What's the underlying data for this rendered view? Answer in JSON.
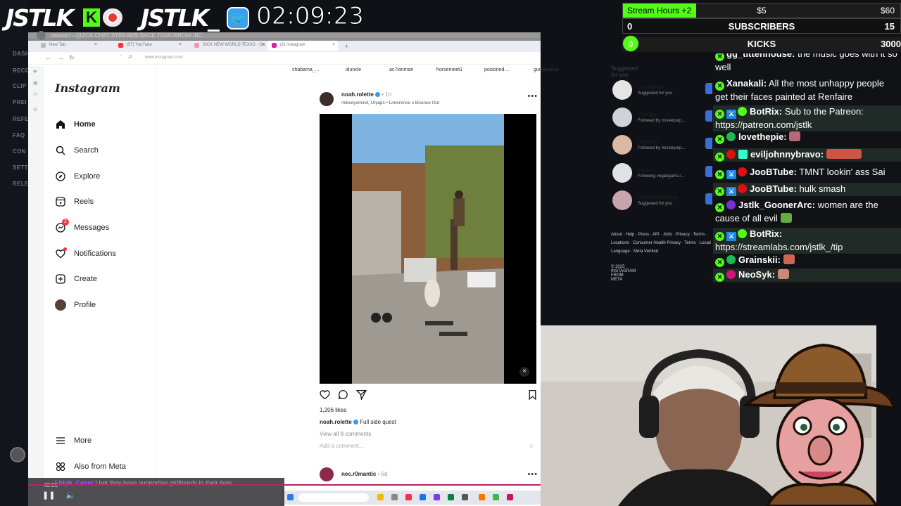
{
  "overlay": {
    "logo_left": "JSTLK",
    "logo_right": "JSTLK_",
    "kick_letter": "K",
    "twitter_glyph": "🐦",
    "timer": "02:09:23",
    "stream_title": "danasirl - QUICK CHAT STREAMS BACK TOMORROW IBC"
  },
  "goals": {
    "hours_label": "Stream Hours +2",
    "hours_mid": "$5",
    "hours_right": "$60",
    "subs_left": "0",
    "subs_label": "SUBSCRIBERS",
    "subs_right": "15",
    "kicks_left": "0",
    "kicks_label": "KICKS",
    "kicks_right": "3000",
    "accent": "#53fc18"
  },
  "dashboard": {
    "items": [
      "DASH",
      "RECO",
      "CLIP",
      "PREI",
      "REFE",
      "FAQ",
      "CON",
      "SETT",
      "RELE"
    ]
  },
  "browser": {
    "tabs": [
      "New Tab",
      "(57) YouTube",
      "SICK NEW WORLD TEXAS - Go",
      "(2) Instagram"
    ],
    "url": "www.instagram.com"
  },
  "instagram": {
    "logo": "Instagram",
    "nav": [
      {
        "label": "Home",
        "icon": "home-icon"
      },
      {
        "label": "Search",
        "icon": "search-icon"
      },
      {
        "label": "Explore",
        "icon": "compass-icon"
      },
      {
        "label": "Reels",
        "icon": "reels-icon"
      },
      {
        "label": "Messages",
        "icon": "messenger-icon"
      },
      {
        "label": "Notifications",
        "icon": "heart-icon"
      },
      {
        "label": "Create",
        "icon": "plus-square-icon"
      },
      {
        "label": "Profile",
        "icon": "profile-icon"
      }
    ],
    "messages_badge": "2",
    "more_label": "More",
    "meta_label": "Also from Meta",
    "stories": [
      "shabama_...",
      "iduncle",
      "ac7ionman",
      "horsemeet1",
      "poisoned....",
      "gumawawa"
    ],
    "post": {
      "user": "noah.rolette",
      "time": "• 1h",
      "subline": "mikeeysmind, Unjaps • Limerence x Bounce Out",
      "likes": "1,206 likes",
      "caption_user": "noah.rolette",
      "caption_text": "Full side quest",
      "view_comments": "View all 8 comments",
      "add_comment": "Add a comment..."
    },
    "next_post": {
      "user": "nec.r0mantic",
      "time": "• 6d"
    },
    "suggested_title": "Suggested for you",
    "suggestions": [
      {
        "name": "aracelbitch",
        "sub": "Suggested for you"
      },
      {
        "name": "_cxclips_",
        "sub": "Followed by mrseepurp..."
      },
      {
        "name": "andiraytv",
        "sub": "Followed by mrseepurp..."
      },
      {
        "name": "lav.jus",
        "sub": "Following vegangains.r..."
      },
      {
        "name": "mistressrubyroze",
        "sub": "Suggested for you"
      }
    ],
    "footer": "About · Help · Press · API · Jobs · Privacy · Terms · Locations · Consumer Health Privacy · Terms · Locati Language · Meta Verified",
    "copyright": "© 2025 INSTAGRAM FROM META"
  },
  "vod": {
    "time": "43:06",
    "comment_user": "Lhigh_Caner",
    "comment_text": "I bet they have supportive girlfriends in their lives"
  },
  "chat": [
    {
      "user": "gg_tittenhouse:",
      "msg": " the music goes with it so well",
      "badges": [
        "kick"
      ]
    },
    {
      "user": "Xanakali:",
      "msg": " All the most unhappy people get their faces painted at Renfaire",
      "badges": [
        "kick"
      ]
    },
    {
      "user": "BotRix:",
      "msg": " Sub to the Patreon: https://patreon.com/jstlk",
      "badges": [
        "kick",
        "mod",
        "verified"
      ]
    },
    {
      "user": "lovethepie:",
      "msg": "",
      "badges": [
        "kick",
        "green"
      ]
    },
    {
      "user": "eviljohnnybravo:",
      "msg": "",
      "badges": [
        "kick",
        "red",
        "sub"
      ]
    },
    {
      "user": "JooBTube:",
      "msg": " TMNT lookin' ass Sai",
      "badges": [
        "kick",
        "mod",
        "red"
      ]
    },
    {
      "user": "JooBTube:",
      "msg": " hulk smash",
      "badges": [
        "kick",
        "mod",
        "red"
      ]
    },
    {
      "user": "Jstlk_GoonerArc:",
      "msg": " women are the cause of all evil",
      "badges": [
        "kick",
        "purple"
      ]
    },
    {
      "user": "BotRix:",
      "msg": " https://streamlabs.com/jstlk_/tip",
      "badges": [
        "kick",
        "mod",
        "verified"
      ]
    },
    {
      "user": "Grainskii:",
      "msg": "",
      "badges": [
        "kick",
        "green"
      ]
    },
    {
      "user": "NeoSyk:",
      "msg": "",
      "badges": [
        "kick",
        "pink"
      ]
    }
  ]
}
